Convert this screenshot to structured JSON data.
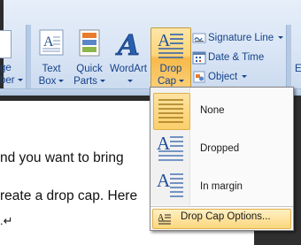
{
  "ribbon": {
    "partial_button": {
      "line1": "ge",
      "line2": "ber"
    },
    "text_box": {
      "line1": "Text",
      "line2": "Box"
    },
    "quick_parts": {
      "line1": "Quick",
      "line2": "Parts"
    },
    "wordart": {
      "line1": "WordArt"
    },
    "drop_cap": {
      "line1": "Drop",
      "line2": "Cap"
    },
    "signature_line": "Signature Line",
    "date_time": "Date & Time",
    "object": "Object",
    "partial_right": "E"
  },
  "document": {
    "line1": "nd you want to bring",
    "line2": "reate a drop cap. Here",
    "line3": ".↵"
  },
  "drop_cap_menu": {
    "items": [
      {
        "label": "None"
      },
      {
        "label": "Dropped"
      },
      {
        "label": "In margin"
      }
    ],
    "options_label": "Drop Cap Options..."
  },
  "icon_letter": "A",
  "colors": {
    "ribbon_text": "#15428b",
    "highlight": "#fcd47a",
    "icon_blue": "#2a5fae"
  }
}
